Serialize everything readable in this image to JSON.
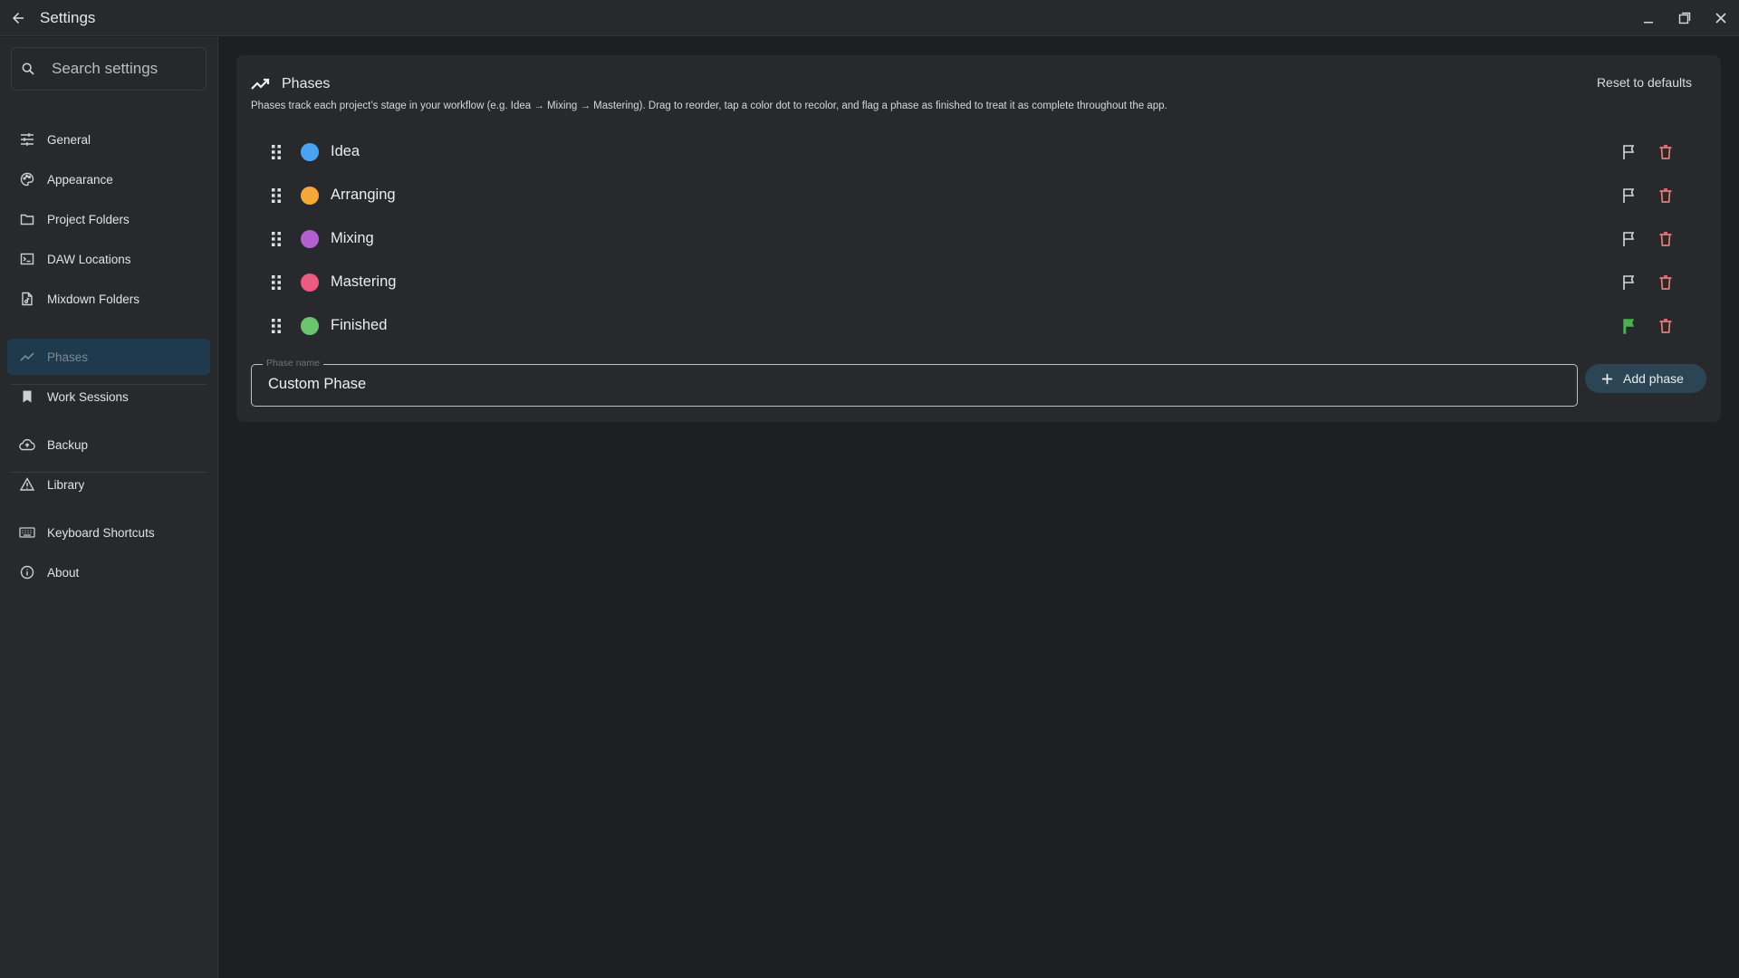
{
  "window": {
    "title": "Settings"
  },
  "search": {
    "placeholder": "Search settings"
  },
  "sidebar": {
    "items": [
      {
        "label": "General",
        "icon": "sliders-icon"
      },
      {
        "label": "Appearance",
        "icon": "palette-icon"
      },
      {
        "label": "Project Folders",
        "icon": "folder-icon"
      },
      {
        "label": "DAW Locations",
        "icon": "terminal-icon"
      },
      {
        "label": "Mixdown Folders",
        "icon": "file-audio-icon"
      },
      {
        "label": "Phases",
        "icon": "trend-icon",
        "active": true
      },
      {
        "label": "Work Sessions",
        "icon": "bookmark-icon"
      },
      {
        "label": "Backup",
        "icon": "cloud-upload-icon"
      },
      {
        "label": "Library",
        "icon": "warning-icon"
      },
      {
        "label": "Keyboard Shortcuts",
        "icon": "keyboard-icon"
      },
      {
        "label": "About",
        "icon": "info-icon"
      }
    ]
  },
  "phases_panel": {
    "title": "Phases",
    "reset_label": "Reset to defaults",
    "description": "Phases track each project’s stage in your workflow (e.g. Idea → Mixing → Mastering). Drag to reorder, tap a color dot to recolor, and flag a phase as finished to treat it as complete throughout the app.",
    "phases": [
      {
        "name": "Idea",
        "color": "#4aa3f0",
        "finished": false
      },
      {
        "name": "Arranging",
        "color": "#f5a83a",
        "finished": false
      },
      {
        "name": "Mixing",
        "color": "#b45fcf",
        "finished": false
      },
      {
        "name": "Mastering",
        "color": "#ec5a82",
        "finished": false
      },
      {
        "name": "Finished",
        "color": "#6cc36f",
        "finished": true
      }
    ],
    "new_phase": {
      "label": "Phase name",
      "value": "Custom Phase"
    },
    "add_label": "Add phase"
  },
  "colors": {
    "accent": "#2c4555",
    "active_nav": "#1f3a4d",
    "delete": "#f07a7a",
    "finished_flag": "#4caf50"
  }
}
